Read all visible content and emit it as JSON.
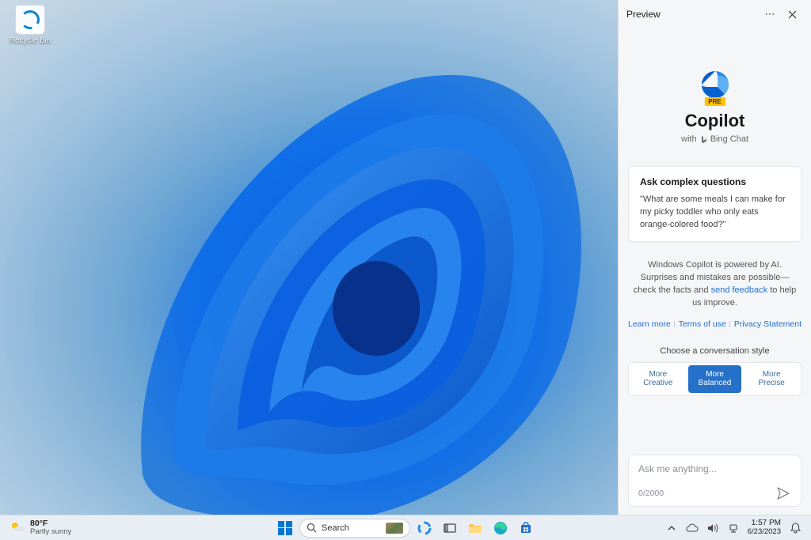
{
  "desktop": {
    "recycle_bin_label": "Recycle Bin"
  },
  "copilot": {
    "header_title": "Preview",
    "pre_badge": "PRE",
    "brand_name": "Copilot",
    "brand_sub_prefix": "with",
    "brand_sub_product": "Bing Chat",
    "card_title": "Ask complex questions",
    "card_body": "\"What are some meals I can make for my picky toddler who only eats orange-colored food?\"",
    "disclaimer_a": "Windows Copilot is powered by AI. Surprises and mistakes are possible—check the facts and ",
    "disclaimer_link": "send feedback",
    "disclaimer_b": " to help us improve.",
    "links": {
      "learn_more": "Learn more",
      "terms": "Terms of use",
      "privacy": "Privacy Statement"
    },
    "style_heading": "Choose a conversation style",
    "styles": [
      {
        "l1": "More",
        "l2": "Creative",
        "selected": false
      },
      {
        "l1": "More",
        "l2": "Balanced",
        "selected": true
      },
      {
        "l1": "More",
        "l2": "Precise",
        "selected": false
      }
    ],
    "input_placeholder": "Ask me anything...",
    "input_counter": "0/2000"
  },
  "taskbar": {
    "weather_temp": "80°F",
    "weather_cond": "Partly sunny",
    "search_label": "Search",
    "clock_time": "1:57 PM",
    "clock_date": "6/23/2023"
  }
}
